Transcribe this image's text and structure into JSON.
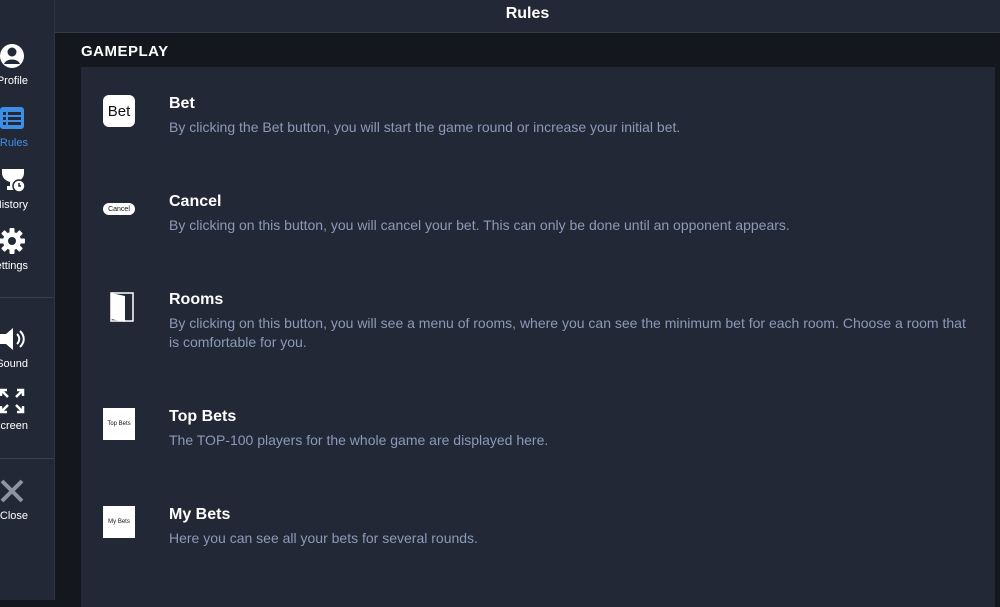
{
  "header": {
    "title": "Rules"
  },
  "sidebar": {
    "items": [
      {
        "label": "Profile",
        "icon": "user-icon",
        "active": false
      },
      {
        "label": "Rules",
        "icon": "list-icon",
        "active": true
      },
      {
        "label": "History",
        "icon": "trophy-clock-icon",
        "active": false
      },
      {
        "label": "Settings",
        "icon": "gear-icon",
        "active": false
      },
      {
        "label": "Sound",
        "icon": "speaker-icon",
        "active": false
      },
      {
        "label": "Fullscreen",
        "icon": "fullscreen-icon",
        "active": false
      },
      {
        "label": "Close",
        "icon": "close-icon",
        "active": false
      }
    ]
  },
  "section": {
    "title": "GAMEPLAY"
  },
  "rules": [
    {
      "icon_text": "Bet",
      "icon": "bet-button-icon",
      "title": "Bet",
      "desc": "By clicking the Bet button, you will start the game round or increase your initial bet."
    },
    {
      "icon_text": "Cancel",
      "icon": "cancel-button-icon",
      "title": "Cancel",
      "desc": "By clicking on this button, you will cancel your bet. This can only be done until an opponent appears."
    },
    {
      "icon": "door-icon",
      "title": "Rooms",
      "desc": "By clicking on this button, you will see a menu of rooms, where you can see the minimum bet for each room. Choose a room that is comfortable for you."
    },
    {
      "icon_text": "Top Bets",
      "icon": "top-bets-icon",
      "title": "Top Bets",
      "desc": "The TOP-100 players for the whole game are displayed here."
    },
    {
      "icon_text": "My Bets",
      "icon": "my-bets-icon",
      "title": "My Bets",
      "desc": "Here you can see all your bets for several rounds."
    }
  ],
  "colors": {
    "background": "#14171e",
    "panel": "#232836",
    "accent": "#3f8ee6",
    "text_muted": "#8b9ab8"
  }
}
